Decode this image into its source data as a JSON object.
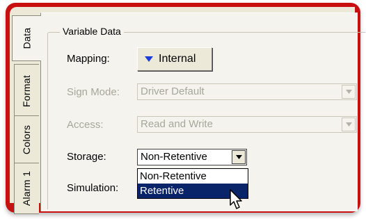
{
  "tabs": [
    {
      "label": "Data",
      "active": true
    },
    {
      "label": "Format",
      "active": false
    },
    {
      "label": "Colors",
      "active": false
    },
    {
      "label": "Alarm 1",
      "active": false
    }
  ],
  "group_title": "Variable Data",
  "mapping": {
    "label": "Mapping:",
    "button_label": "Internal"
  },
  "sign_mode": {
    "label": "Sign Mode:",
    "value": "Driver Default",
    "enabled": false
  },
  "access": {
    "label": "Access:",
    "value": "Read and Write",
    "enabled": false
  },
  "storage": {
    "label": "Storage:",
    "value": "Non-Retentive",
    "options": [
      "Non-Retentive",
      "Retentive"
    ],
    "highlighted_option": "Retentive"
  },
  "simulation": {
    "label": "Simulation:"
  },
  "colors": {
    "frame": "#c81010",
    "dialog": "#f4f3ee",
    "selection": "#0a246a",
    "mapping_arrow": "#1a3cdc"
  }
}
